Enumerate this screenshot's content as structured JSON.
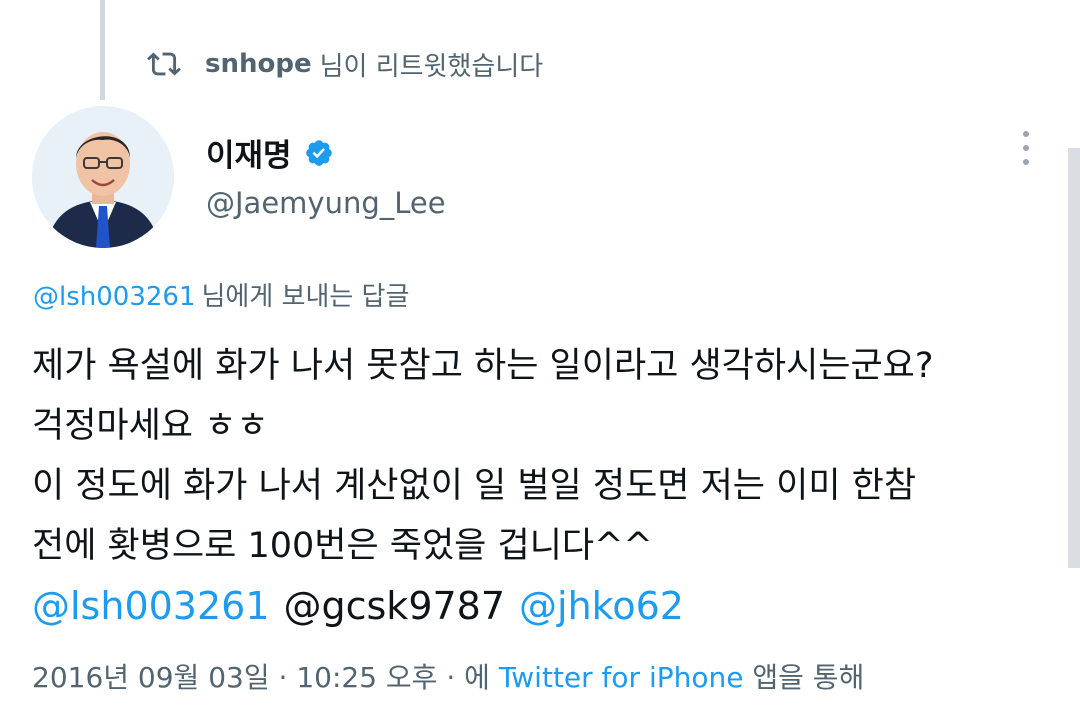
{
  "retweet": {
    "user": "snhope",
    "suffix": "님이 리트윗했습니다"
  },
  "author": {
    "name": "이재명",
    "handle": "@Jaemyung_Lee",
    "verified": true
  },
  "reply": {
    "mention": "@lsh003261",
    "suffix": "님에게 보내는 답글"
  },
  "tweet": {
    "lines": [
      "제가 욕설에 화가 나서 못참고 하는 일이라고 생각하시는군요?",
      "걱정마세요 ㅎㅎ",
      "이 정도에 화가 나서 계산없이 일 벌일 정도면 저는 이미 한참",
      "전에 홧병으로 100번은 죽었을 겁니다^^"
    ],
    "mentions": [
      "@lsh003261",
      "@gcsk9787",
      "@jhko62"
    ]
  },
  "meta": {
    "date": "2016년 09월 03일",
    "sep1": " · ",
    "time": "10:25 오후",
    "sep2": " · ",
    "via_prefix": "에 ",
    "app": "Twitter for iPhone",
    "via_suffix": " 앱을 통해"
  },
  "colors": {
    "accent": "#1d9bf0",
    "text": "#0f1419",
    "secondary": "#536471"
  }
}
